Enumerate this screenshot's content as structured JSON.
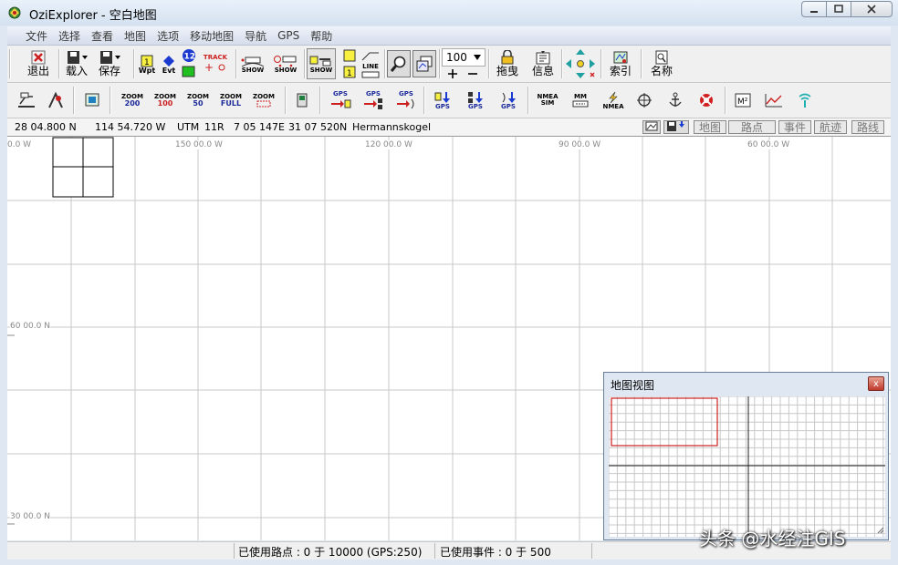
{
  "window": {
    "title": "OziExplorer - 空白地图"
  },
  "menu": [
    "文件",
    "选择",
    "查看",
    "地图",
    "选项",
    "移动地图",
    "导航",
    "GPS",
    "帮助"
  ],
  "toolbar1": {
    "exit": "退出",
    "load": "载入",
    "save": "保存",
    "wpt": "Wpt",
    "evt": "Evt",
    "track": "TRACK",
    "show": "SHOW",
    "line": "LINE",
    "zoom_value": "100",
    "drag": "拖曳",
    "info": "信息",
    "index": "索引",
    "name": "名称"
  },
  "toolbar2": {
    "zoom_200": [
      "ZOOM",
      "200"
    ],
    "zoom_100": [
      "ZOOM",
      "100"
    ],
    "zoom_50": [
      "ZOOM",
      "50"
    ],
    "zoom_full": [
      "ZOOM",
      "FULL"
    ],
    "zoom_box": "ZOOM",
    "gps": "GPS",
    "nmea_sim": [
      "NMEA",
      "SIM"
    ],
    "mm": "MM",
    "nmea": "NMEA",
    "m2": "M²"
  },
  "coords": {
    "lat": "28 04.800 N",
    "lon": "114 54.720 W",
    "utm_label": "UTM",
    "zone": "11R",
    "easting": "7 05 147E",
    "northing": "31 07 520N",
    "place": "Hermannskogel"
  },
  "tabs": [
    "地图",
    "路点",
    "事件",
    "航迹",
    "路线"
  ],
  "grid_labels": {
    "top": [
      "0.0 W",
      "150 00.0 W",
      "120 00.0 W",
      "90 00.0 W",
      "60 00.0 W"
    ],
    "left": [
      "60 00.0 N",
      "30 00.0 N"
    ]
  },
  "status": {
    "waypoints": "已使用路点 : 0 于 10000  (GPS:250)",
    "events": "已使用事件 : 0 于 500"
  },
  "overview": {
    "title": "地图视图",
    "close": "x"
  },
  "watermark": "头条 @水经注GIS",
  "colors": {
    "accent_red": "#cc2020",
    "zoom_blue": "#1a2a9a",
    "gps_red": "#d02020"
  }
}
